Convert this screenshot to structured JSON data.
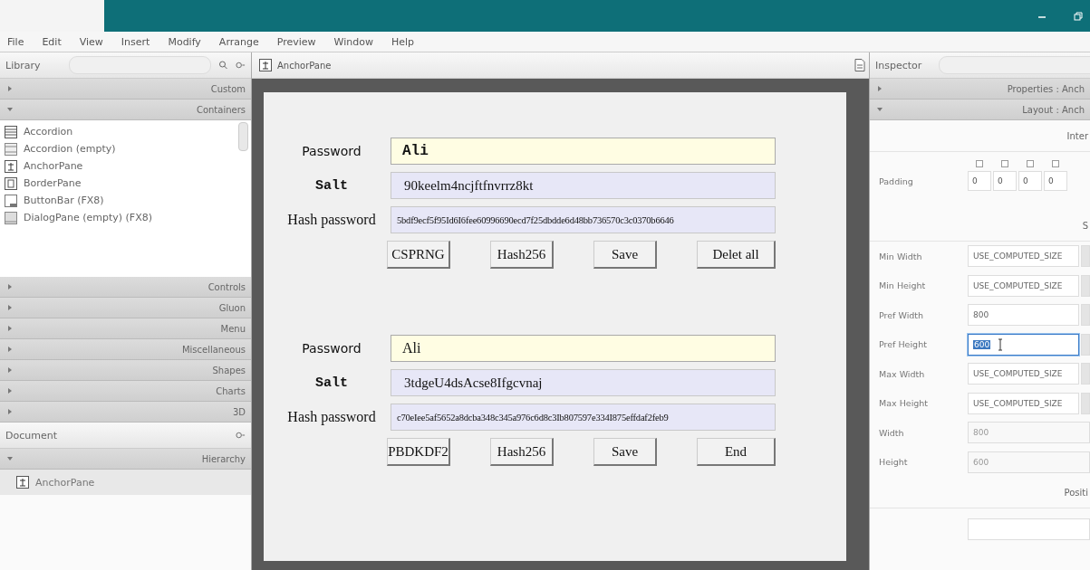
{
  "menu": [
    "File",
    "Edit",
    "View",
    "Insert",
    "Modify",
    "Arrange",
    "Preview",
    "Window",
    "Help"
  ],
  "library": {
    "title": "Library",
    "sections": [
      {
        "label": "Custom",
        "expanded": false
      },
      {
        "label": "Containers",
        "expanded": true,
        "items": [
          {
            "label": "Accordion",
            "kind": "accordion"
          },
          {
            "label": "Accordion  (empty)",
            "kind": "accordion-empty"
          },
          {
            "label": "AnchorPane",
            "kind": "anchor"
          },
          {
            "label": "BorderPane",
            "kind": "border"
          },
          {
            "label": "ButtonBar  (FX8)",
            "kind": "bar"
          },
          {
            "label": "DialogPane (empty)  (FX8)",
            "kind": "dialog"
          }
        ]
      },
      {
        "label": "Controls",
        "expanded": false
      },
      {
        "label": "Gluon",
        "expanded": false
      },
      {
        "label": "Menu",
        "expanded": false
      },
      {
        "label": "Miscellaneous",
        "expanded": false
      },
      {
        "label": "Shapes",
        "expanded": false
      },
      {
        "label": "Charts",
        "expanded": false
      },
      {
        "label": "3D",
        "expanded": false
      }
    ]
  },
  "document": {
    "title": "Document",
    "sections": [
      {
        "label": "Hierarchy",
        "expanded": true,
        "items": [
          {
            "label": "AnchorPane",
            "kind": "anchor"
          }
        ]
      }
    ]
  },
  "canvas": {
    "breadcrumb": "AnchorPane",
    "forms": [
      {
        "password_label": "Password",
        "password": "Ali",
        "salt_label": "Salt",
        "salt": "90keelm4ncjftfnvrrz8kt",
        "hash_label": "Hash password",
        "hash": "5bdf9ecf5f95Id6I6fee60996690ecd7f25dbdde6d48bb736570c3c0370b6646",
        "buttons": [
          "CSPRNG",
          "Hash256",
          "Save",
          "Delet all"
        ]
      },
      {
        "password_label": "Password",
        "password": "Ali",
        "salt_label": "Salt",
        "salt": "3tdgeU4dsAcse8Ifgcvnaj",
        "hash_label": "Hash password",
        "hash": "c70eIee5af5652a8dcba348c345a976c6d8c3Ib807597e334I875effdaf2feb9",
        "buttons": [
          "PBDKDF2",
          "Hash256",
          "Save",
          "End"
        ]
      }
    ]
  },
  "inspector": {
    "title": "Inspector",
    "sections": [
      {
        "label": "Properties : Anch",
        "expanded": false
      },
      {
        "label": "Layout : Anch",
        "expanded": true
      }
    ],
    "rows": [
      {
        "kind": "heading",
        "label": "Inter"
      },
      {
        "kind": "padding",
        "label": "Padding",
        "values": [
          "0",
          "0",
          "0",
          "0"
        ]
      },
      {
        "kind": "heading",
        "label": "S"
      },
      {
        "kind": "combo",
        "label": "Min Width",
        "value": "USE_COMPUTED_SIZE",
        "focused": false,
        "disabled": false
      },
      {
        "kind": "combo",
        "label": "Min Height",
        "value": "USE_COMPUTED_SIZE",
        "focused": false,
        "disabled": false
      },
      {
        "kind": "combo",
        "label": "Pref Width",
        "value": "800",
        "focused": false,
        "disabled": false
      },
      {
        "kind": "combo",
        "label": "Pref Height",
        "value": "600",
        "focused": true,
        "disabled": false
      },
      {
        "kind": "combo",
        "label": "Max Width",
        "value": "USE_COMPUTED_SIZE",
        "focused": false,
        "disabled": false
      },
      {
        "kind": "combo",
        "label": "Max Height",
        "value": "USE_COMPUTED_SIZE",
        "focused": false,
        "disabled": false
      },
      {
        "kind": "combo",
        "label": "Width",
        "value": "800",
        "focused": false,
        "disabled": true
      },
      {
        "kind": "combo",
        "label": "Height",
        "value": "600",
        "focused": false,
        "disabled": true
      },
      {
        "kind": "heading",
        "label": "Positi"
      }
    ]
  }
}
